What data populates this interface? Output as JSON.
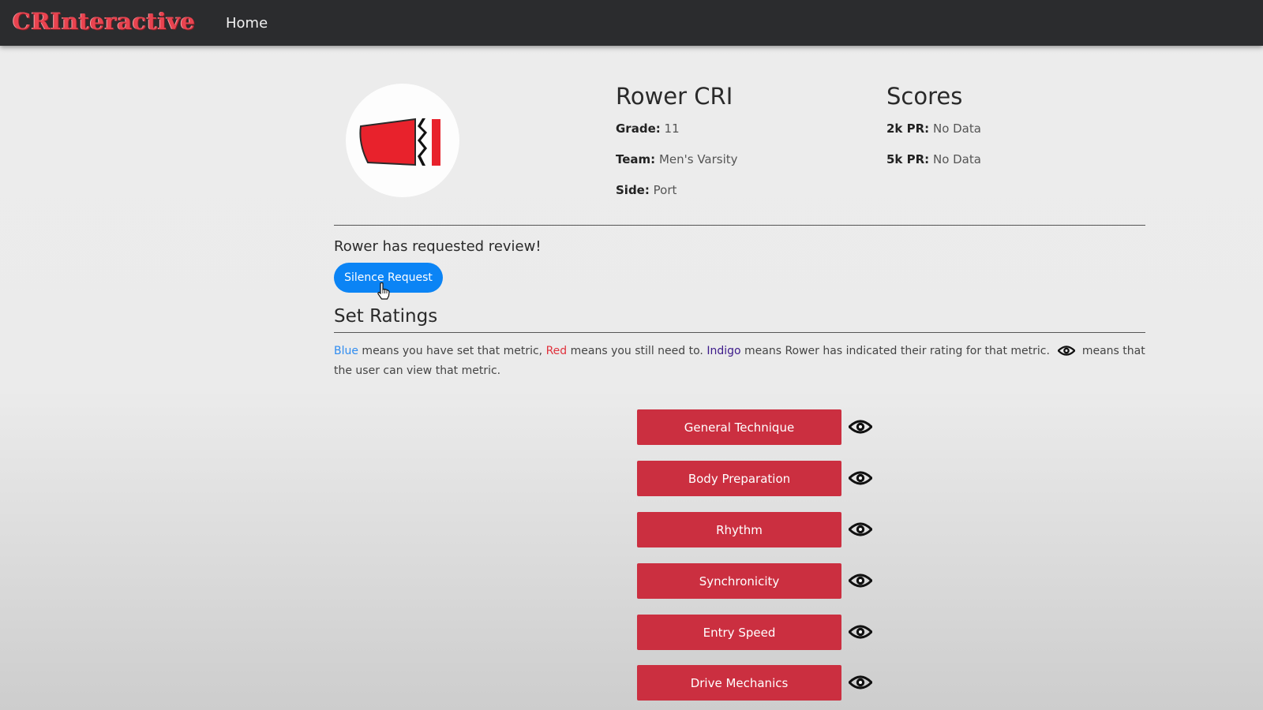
{
  "navbar": {
    "brand": "CRInteractive",
    "home_label": "Home"
  },
  "profile": {
    "name": "Rower CRI",
    "grade_label": "Grade:",
    "grade": "11",
    "team_label": "Team:",
    "team": "Men's Varsity",
    "side_label": "Side:",
    "side": "Port"
  },
  "scores": {
    "title": "Scores",
    "pr2k_label": "2k PR:",
    "pr2k": "No Data",
    "pr5k_label": "5k PR:",
    "pr5k": "No Data"
  },
  "review": {
    "message": "Rower has requested review!",
    "silence_label": "Silence Request"
  },
  "ratings": {
    "title": "Set Ratings",
    "legend": {
      "blue": "Blue",
      "blue_text": " means you have set that metric, ",
      "red": "Red",
      "red_text": " means you still need to. ",
      "indigo": "Indigo",
      "indigo_text": " means Rower has indicated their rating for that metric. ",
      "eye_text": " means that the user can view that metric."
    },
    "metrics": [
      {
        "label": "General Technique"
      },
      {
        "label": "Body Preparation"
      },
      {
        "label": "Rhythm"
      },
      {
        "label": "Synchronicity"
      },
      {
        "label": "Entry Speed"
      },
      {
        "label": "Drive Mechanics"
      }
    ]
  },
  "colors": {
    "navbar": "#2b2c2e",
    "brand": "#e8434f",
    "primary_button": "#0b84f5",
    "metric_button": "#cb2f40",
    "legend_blue": "#2f8cf0",
    "legend_red": "#e0323d",
    "legend_indigo": "#3c1a8a"
  },
  "icons": {
    "metric_visibility": "eye-icon",
    "avatar": "blade-logo-icon",
    "cursor": "hand-pointer-icon"
  }
}
